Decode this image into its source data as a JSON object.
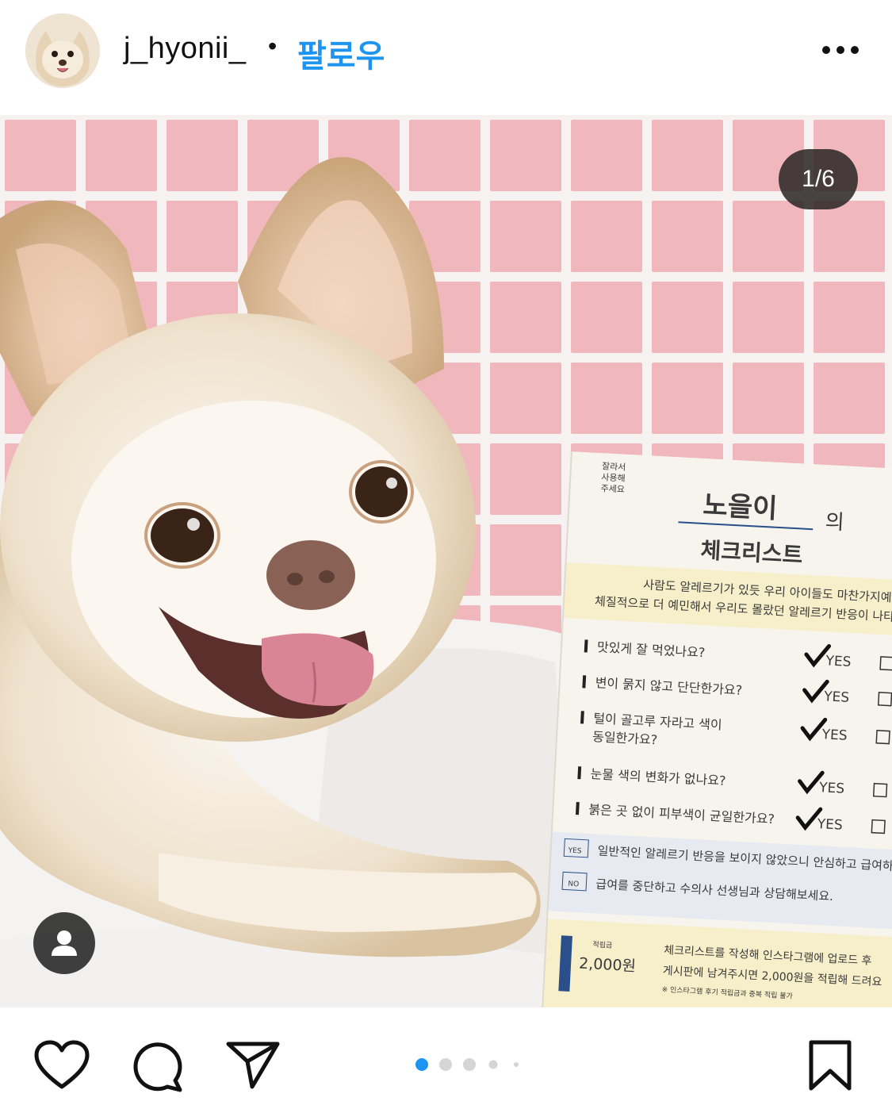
{
  "post": {
    "username": "j_hyonii_",
    "separator": "•",
    "follow_label": "팔로우",
    "more_icon": "more-horizontal-icon"
  },
  "carousel": {
    "counter": "1/6",
    "active_index": 1,
    "total": 6
  },
  "checklist_card": {
    "cut_note": [
      "잘라서",
      "사용해",
      "주세요"
    ],
    "name": "노을이",
    "name_suffix": "의",
    "title": "체크리스트",
    "intro_line1": "사람도 알레르기가 있듯 우리 아이들도 마찬가지예요.",
    "intro_line2": "체질적으로 더 예민해서 우리도 몰랐던 알레르기 반응이 나타날 수",
    "questions": [
      "맛있게 잘 먹었나요?",
      "변이 묽지 않고 단단한가요?",
      "털이 골고루 자라고 색이",
      "동일한가요?",
      "눈물 색의 변화가 없나요?",
      "붉은 곳 없이 피부색이 균일한가요?"
    ],
    "yes_label": "YES",
    "no_label": "NO",
    "yes_result": "일반적인 알레르기 반응을 보이지 않았으니 안심하고 급여하세",
    "no_result": "급여를 중단하고 수의사 선생님과 상담해보세요.",
    "points_label": "적립금",
    "points_value": "2,000원",
    "reward_line1": "체크리스트를 작성해 인스타그램에 업로드 후",
    "reward_line2": "게시판에 남겨주시면 2,000원을 적립해 드려요",
    "reward_note": "※ 인스타그램 후기 적립금과 중복 적립 불가"
  },
  "actions": {
    "like_icon": "heart-icon",
    "comment_icon": "comment-icon",
    "share_icon": "send-icon",
    "save_icon": "bookmark-icon",
    "tag_icon": "user-tag-icon"
  },
  "colors": {
    "accent": "#1d95f0",
    "tile_pink": "#f0b7bd",
    "card_yellow": "#f7efc9",
    "card_blue": "#2a4f8a"
  }
}
